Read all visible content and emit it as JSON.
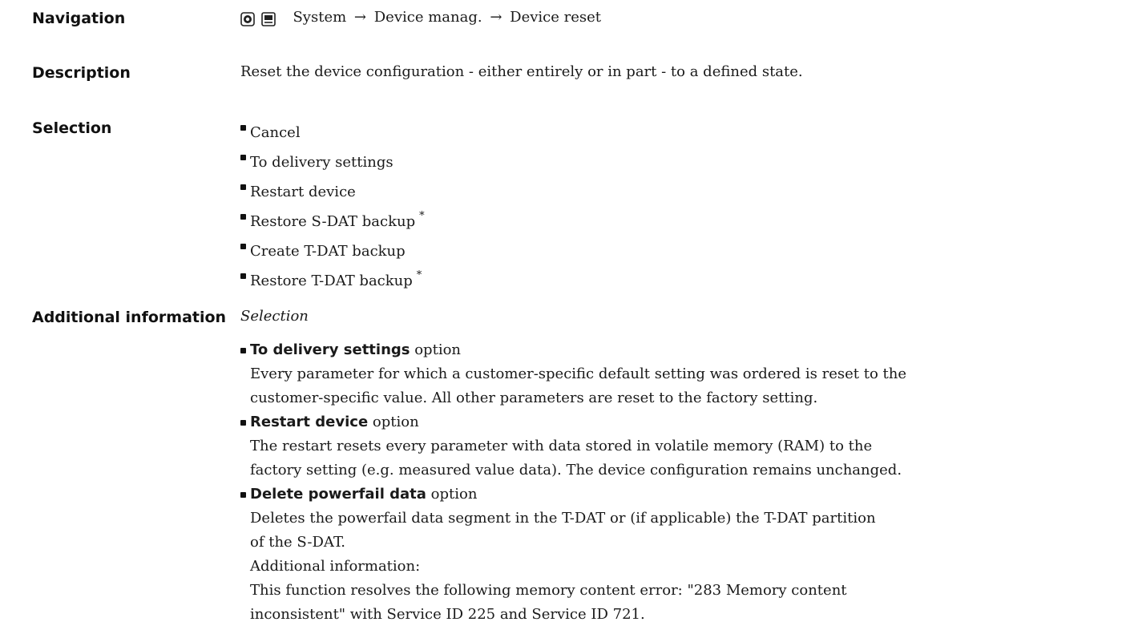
{
  "navigation": {
    "label": "Navigation",
    "path": [
      "System",
      "Device manag.",
      "Device reset"
    ],
    "arrow": "→"
  },
  "description": {
    "label": "Description",
    "text": "Reset the device configuration - either entirely or in part - to a defined state."
  },
  "selection": {
    "label": "Selection",
    "options": [
      {
        "text": "Cancel",
        "star": ""
      },
      {
        "text": "To delivery settings",
        "star": ""
      },
      {
        "text": "Restart device",
        "star": ""
      },
      {
        "text": "Restore S-DAT backup",
        "star": "*"
      },
      {
        "text": "Create T-DAT backup",
        "star": ""
      },
      {
        "text": "Restore T-DAT backup",
        "star": "*"
      }
    ]
  },
  "additional": {
    "label": "Additional information",
    "subheading": "Selection",
    "items": [
      {
        "title": "To delivery settings",
        "suffix": " option",
        "lines": [
          "Every parameter for which a customer-specific default setting was ordered is reset to the",
          "customer-specific value. All other parameters are reset to the factory setting."
        ]
      },
      {
        "title": "Restart device",
        "suffix": " option",
        "lines": [
          "The restart resets every parameter with data stored in volatile memory (RAM) to the",
          "factory setting (e.g. measured value data). The device configuration remains unchanged."
        ]
      },
      {
        "title": "Delete powerfail data",
        "suffix": " option",
        "lines": [
          "Deletes the powerfail data segment in the T-DAT or (if applicable) the T-DAT partition",
          "of the S-DAT.",
          "Additional information:",
          "This function resolves the following memory content error: \"283 Memory content",
          "inconsistent\" with Service ID 225 and Service ID 721."
        ]
      }
    ]
  }
}
